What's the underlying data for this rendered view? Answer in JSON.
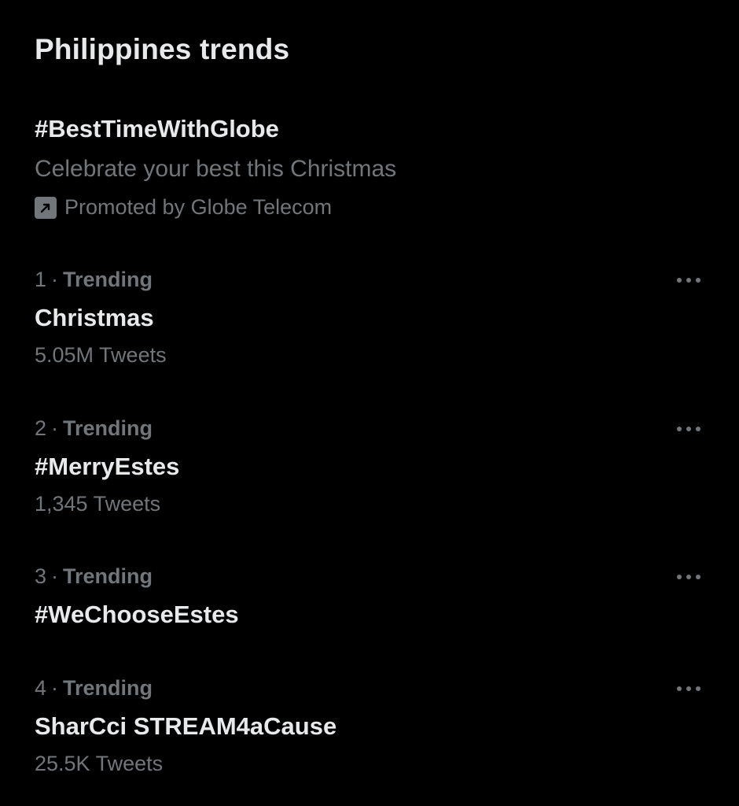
{
  "panel": {
    "title": "Philippines trends"
  },
  "promoted": {
    "hashtag": "#BestTimeWithGlobe",
    "description": "Celebrate your best this Christmas",
    "promoted_by": "Promoted by Globe Telecom",
    "icon": "promoted-arrow-icon"
  },
  "trends": [
    {
      "rank": "1",
      "context": "Trending",
      "name": "Christmas",
      "count": "5.05M Tweets"
    },
    {
      "rank": "2",
      "context": "Trending",
      "name": "#MerryEstes",
      "count": "1,345 Tweets"
    },
    {
      "rank": "3",
      "context": "Trending",
      "name": "#WeChooseEstes",
      "count": ""
    },
    {
      "rank": "4",
      "context": "Trending",
      "name": "SharCci STREAM4aCause",
      "count": "25.5K Tweets"
    }
  ],
  "separator": "·",
  "more_icon": "more-dots-icon",
  "colors": {
    "background": "#000000",
    "primary_text": "#e7e9ea",
    "secondary_text": "#71767b"
  }
}
